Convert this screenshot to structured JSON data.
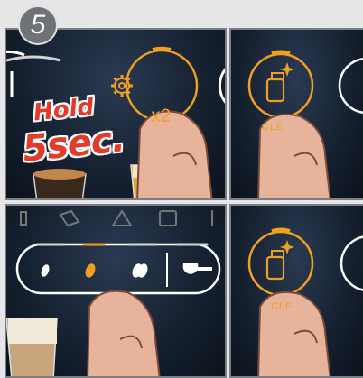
{
  "step": {
    "number": "5"
  },
  "overlay": {
    "hold_line1": "Hold",
    "hold_line2": "5sec."
  },
  "panel1": {
    "multiplier": "x2"
  },
  "panel2": {
    "clean_label": "CLE"
  },
  "panel4": {
    "clean_label": "CLE"
  },
  "colors": {
    "accent": "#f0a020",
    "warning": "#e23b2c",
    "panel": "#15202f",
    "ring": "#ffffff"
  },
  "icons": [
    "settings-gear-icon",
    "clean-icon",
    "bean-icon",
    "powder-scoop-icon",
    "water-tank-icon",
    "drip-tray-icon",
    "warning-icon",
    "grounds-container-icon",
    "filter-icon"
  ]
}
